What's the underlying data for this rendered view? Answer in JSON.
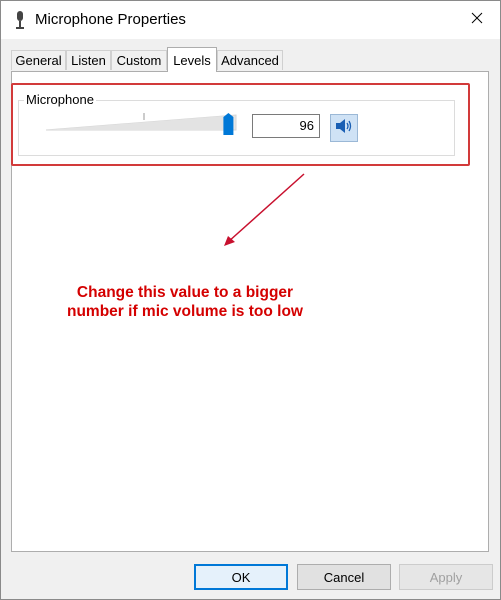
{
  "window": {
    "title": "Microphone Properties",
    "icon": "microphone-icon",
    "close_icon": "close-icon"
  },
  "tabs": [
    {
      "label": "General",
      "active": false
    },
    {
      "label": "Listen",
      "active": false
    },
    {
      "label": "Custom",
      "active": false
    },
    {
      "label": "Levels",
      "active": true
    },
    {
      "label": "Advanced",
      "active": false
    }
  ],
  "levels": {
    "group_label": "Microphone",
    "slider_value": 96,
    "value_text": "96",
    "mute_icon": "speaker-icon"
  },
  "annotation": {
    "line1": "Change this value to a bigger",
    "line2": "number if mic volume is too low",
    "color": "#d40000",
    "highlight_color": "#d23a3a"
  },
  "buttons": {
    "ok": "OK",
    "cancel": "Cancel",
    "apply": "Apply"
  },
  "colors": {
    "accent": "#0078d7",
    "slider_thumb": "#0078d7"
  }
}
